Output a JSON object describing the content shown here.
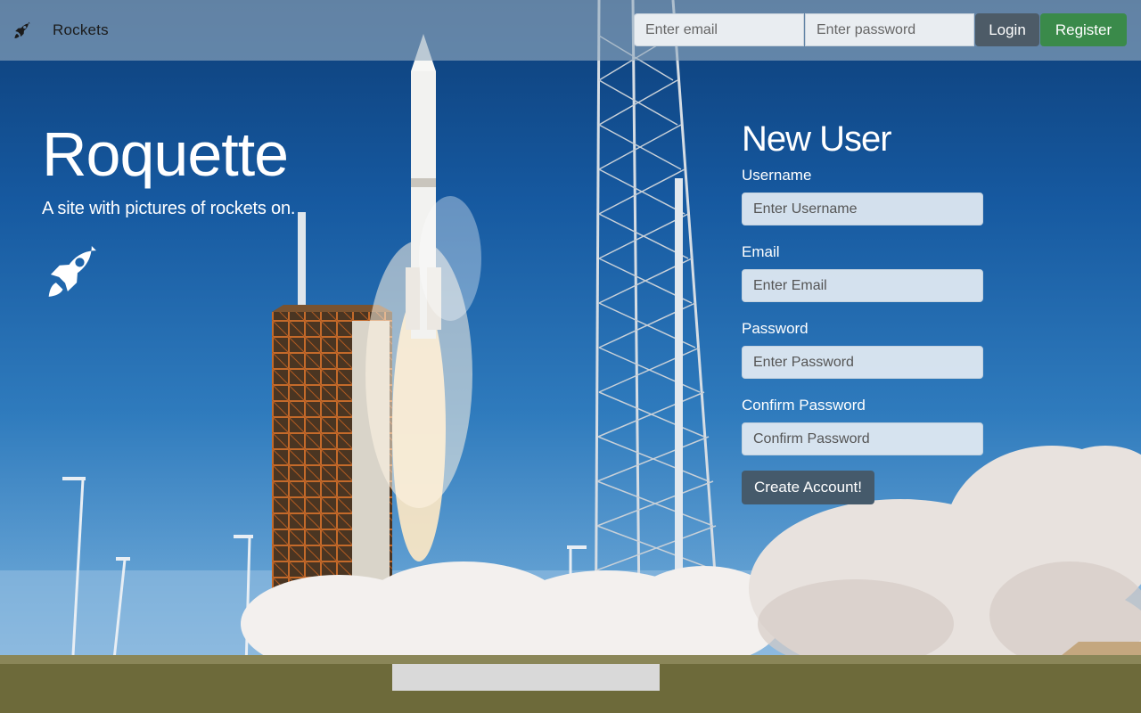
{
  "navbar": {
    "brand": "Rockets",
    "email_placeholder": "Enter email",
    "password_placeholder": "Enter password",
    "login_label": "Login",
    "register_label": "Register"
  },
  "hero": {
    "title": "Roquette",
    "subtitle": "A site with pictures of rockets on."
  },
  "register_form": {
    "title": "New User",
    "fields": [
      {
        "label": "Username",
        "placeholder": "Enter Username"
      },
      {
        "label": "Email",
        "placeholder": "Enter Email"
      },
      {
        "label": "Password",
        "placeholder": "Enter Password"
      },
      {
        "label": "Confirm Password",
        "placeholder": "Confirm Password"
      }
    ],
    "submit_label": "Create Account!"
  },
  "icons": {
    "brand": "rocket-icon",
    "hero": "rocket-icon"
  },
  "colors": {
    "login_button": "#4d5b67",
    "register_button": "#3a8a4a",
    "create_button": "#455a6b",
    "navbar_bg": "#96acc0"
  }
}
